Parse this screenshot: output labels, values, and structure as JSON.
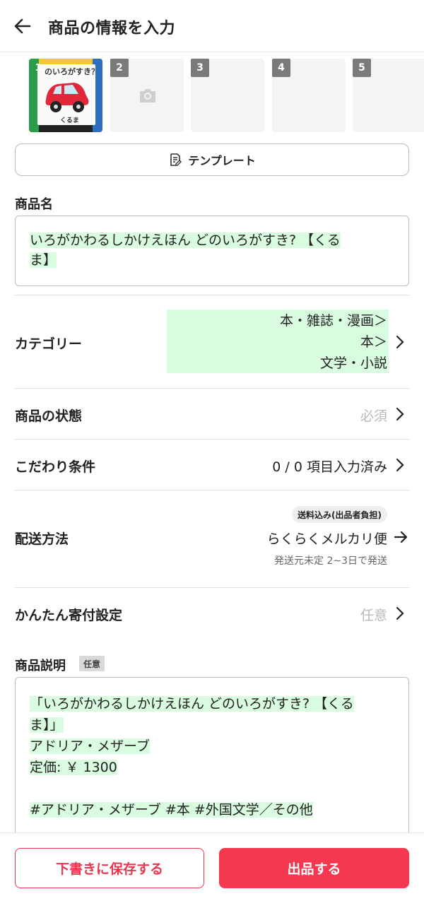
{
  "header": {
    "title": "商品の情報を入力"
  },
  "photos": [
    {
      "num": "1",
      "book_title": "のいろがすき？",
      "book_subtitle": "くるま"
    },
    {
      "num": "2"
    },
    {
      "num": "3"
    },
    {
      "num": "4"
    },
    {
      "num": "5"
    }
  ],
  "template_button": {
    "label": "テンプレート"
  },
  "product_name": {
    "label": "商品名",
    "line1": "いろがかわるしかけえほん どのいろがすき? 【くる",
    "line2": "ま】"
  },
  "category": {
    "label": "カテゴリー",
    "line1": "本・雑誌・漫画＞",
    "line2": "本＞",
    "line3": "文学・小説"
  },
  "condition": {
    "label": "商品の状態",
    "value": "必須"
  },
  "preferences": {
    "label": "こだわり条件",
    "value": "0 / 0 項目入力済み"
  },
  "shipping": {
    "label": "配送方法",
    "badge": "送料込み(出品者負担)",
    "value": "らくらくメルカリ便",
    "sub": "発送元未定 2~3日で発送"
  },
  "donation": {
    "label": "かんたん寄付設定",
    "value": "任意"
  },
  "description": {
    "label": "商品説明",
    "badge": "任意",
    "line1": "「いろがかわるしかけえほん どのいろがすき? 【くる",
    "line2": "ま】」",
    "line3": "アドリア・メザーブ",
    "line4": "定価: ￥ 1300",
    "line5": "",
    "line6": "#アドリア・メザーブ #本 #外国文学／その他"
  },
  "footer": {
    "draft_label": "下書きに保存する",
    "sell_label": "出品する"
  },
  "colors": {
    "accent": "#f5384f",
    "highlight": "#d9fbe0"
  }
}
